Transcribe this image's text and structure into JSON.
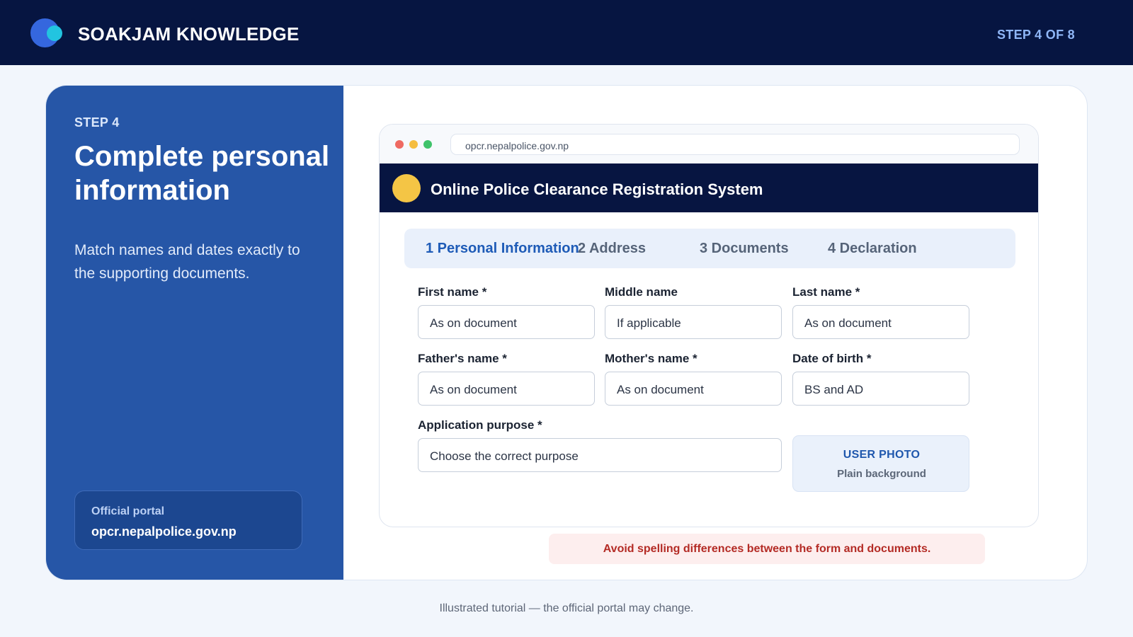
{
  "header": {
    "brand": "SOAKJAM KNOWLEDGE",
    "step_count": "STEP 4 OF 8"
  },
  "left_panel": {
    "step_label": "STEP 4",
    "title": "Complete personal information",
    "description": "Match names and dates exactly to the supporting documents.",
    "portal_label": "Official portal",
    "portal_url": "opcr.nepalpolice.gov.np"
  },
  "browser": {
    "url": "opcr.nepalpolice.gov.np",
    "site_title": "Online Police Clearance Registration System",
    "tabs": [
      {
        "label": "1 Personal Information",
        "active": true
      },
      {
        "label": "2 Address",
        "active": false
      },
      {
        "label": "3 Documents",
        "active": false
      },
      {
        "label": "4 Declaration",
        "active": false
      }
    ],
    "form": {
      "first_name": {
        "label": "First name *",
        "placeholder": "As on document"
      },
      "middle_name": {
        "label": "Middle name",
        "placeholder": "If applicable"
      },
      "last_name": {
        "label": "Last name *",
        "placeholder": "As on document"
      },
      "father_name": {
        "label": "Father's name *",
        "placeholder": "As on document"
      },
      "mother_name": {
        "label": "Mother's name *",
        "placeholder": "As on document"
      },
      "date_of_birth": {
        "label": "Date of birth *",
        "placeholder": "BS and AD"
      },
      "purpose": {
        "label": "Application purpose *",
        "placeholder": "Choose the correct purpose"
      }
    },
    "photo": {
      "title": "USER PHOTO",
      "subtitle": "Plain background"
    }
  },
  "warning": "Avoid spelling differences between the form and documents.",
  "footnote": "Illustrated tutorial — the official portal may change.",
  "colors": {
    "topbar": "#061541",
    "panel_blue": "#2656a7",
    "accent_blue": "#1e5bb7",
    "emblem_yellow": "#f4c545",
    "warning_red": "#b42b25"
  }
}
